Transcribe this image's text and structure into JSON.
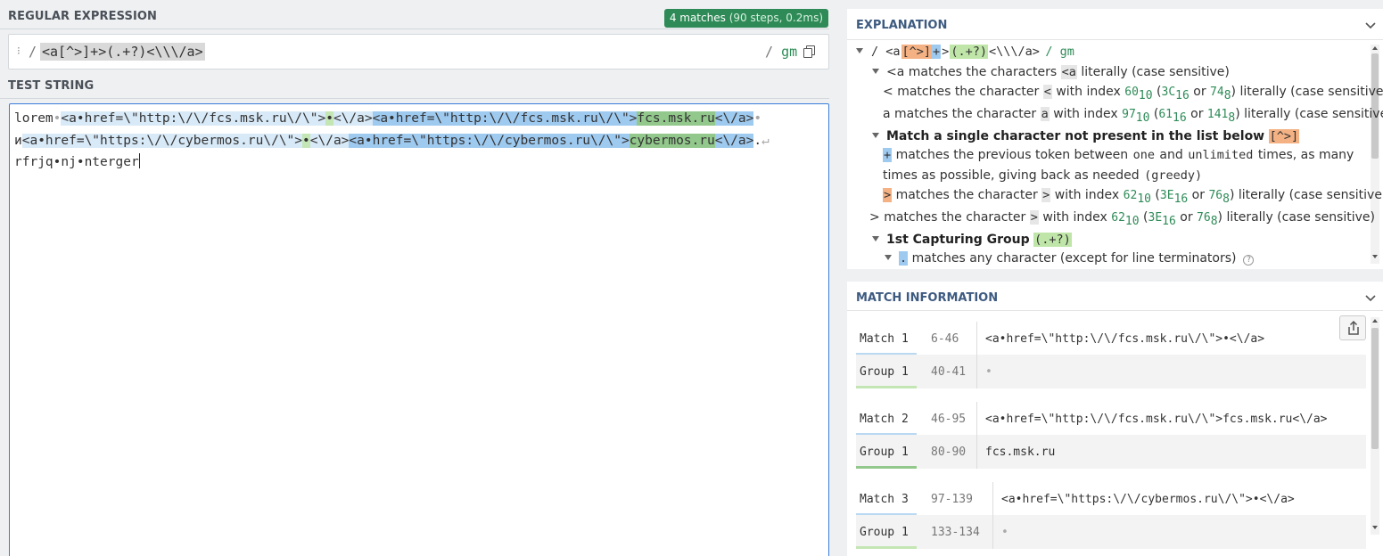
{
  "regex_panel": {
    "title": "REGULAR EXPRESSION",
    "matches_badge": "4 matches",
    "matches_detail": "(90 steps, 0.2ms)",
    "delimiter": "/",
    "pattern": "<a[^>]+>(.+?)<\\\\\\/a>",
    "flags_prefix": "/",
    "flags": "gm"
  },
  "test_panel": {
    "title": "TEST STRING",
    "line1": [
      {
        "t": "lorem",
        "c": ""
      },
      {
        "t": "•",
        "c": "ws"
      },
      {
        "t": "<a•href=\\\"http:\\/\\/fcs.msk.ru\\/\\\">",
        "c": "m-alt"
      },
      {
        "t": "•",
        "c": "g-light"
      },
      {
        "t": "<\\/a>",
        "c": "m-alt"
      },
      {
        "t": "<a•href=\\\"http:\\/\\/fcs.msk.ru\\/\\\">",
        "c": "m-blue"
      },
      {
        "t": "fcs.msk.ru",
        "c": "g-dark"
      },
      {
        "t": "<\\/a>",
        "c": "m-blue"
      },
      {
        "t": "•",
        "c": "ws"
      }
    ],
    "line2": [
      {
        "t": "и",
        "c": ""
      },
      {
        "t": "<a•href=\\\"https:\\/\\/cybermos.ru\\/\\\">",
        "c": "m-alt"
      },
      {
        "t": "•",
        "c": "g-light"
      },
      {
        "t": "<\\/a>",
        "c": "m-alt"
      },
      {
        "t": "<a•href=\\\"https:\\/\\/cybermos.ru\\/\\\">",
        "c": "m-blue"
      },
      {
        "t": "cybermos.ru",
        "c": "g-dark"
      },
      {
        "t": "<\\/a>",
        "c": "m-blue"
      },
      {
        "t": ".",
        "c": ""
      },
      {
        "t": "↵",
        "c": "ws"
      }
    ],
    "line3": "rfrjq•nj•nterger"
  },
  "explanation": {
    "title": "EXPLANATION",
    "root_open": "/ <a",
    "root_class": "[^>]",
    "root_plus": "+",
    "root_gt": ">",
    "root_group": "(.+?)",
    "root_tail": "<\\\\\\/a>",
    "root_flags": "/ gm",
    "row_a": {
      "token": "<a",
      "text1": "matches the characters",
      "lit": "<a",
      "text2": "literally (case sensitive)"
    },
    "row_lt": {
      "token": "<",
      "text1": "matches the character",
      "lit": "<",
      "text2": "with index",
      "dec": "60",
      "dec_base": "10",
      "hex": "3C",
      "hex_base": "16",
      "oct": "74",
      "oct_base": "8",
      "or": "or",
      "text3": "literally (case sensitive)"
    },
    "row_achar": {
      "token": "a",
      "text1": "matches the character",
      "lit": "a",
      "text2": "with index",
      "dec": "97",
      "dec_base": "10",
      "hex": "61",
      "hex_base": "16",
      "oct": "141",
      "oct_base": "8",
      "or": "or",
      "text3": "literally (case sensitive)"
    },
    "row_class": {
      "title": "Match a single character not present in the list below",
      "token": "[^>]"
    },
    "row_plus": {
      "token": "+",
      "text1": "matches the previous token between",
      "one": "one",
      "and": "and",
      "unlimited": "unlimited",
      "text2": "times, as many",
      "text3": "times as possible, giving back as needed",
      "greedy": "(greedy)"
    },
    "row_gt_in": {
      "token": ">",
      "text1": "matches the character",
      "lit": ">",
      "text2": "with index",
      "dec": "62",
      "dec_base": "10",
      "hex": "3E",
      "hex_base": "16",
      "oct": "76",
      "oct_base": "8",
      "or": "or",
      "text3": "literally (case sensitive)"
    },
    "row_gt": {
      "token": ">",
      "text1": "matches the character",
      "lit": ">",
      "text2": "with index",
      "dec": "62",
      "dec_base": "10",
      "hex": "3E",
      "hex_base": "16",
      "oct": "76",
      "oct_base": "8",
      "or": "or",
      "text3": "literally (case sensitive)"
    },
    "row_group": {
      "title": "1st Capturing Group",
      "token": "(.+?)"
    },
    "row_dot": {
      "token": ".",
      "text": "matches any character (except for line terminators)",
      "help": "?"
    }
  },
  "match_info": {
    "title": "MATCH INFORMATION",
    "rows": [
      {
        "label": "Match 1",
        "range": "6-46",
        "value": "<a•href=\\\"http:\\/\\/fcs.msk.ru\\/\\\">•<\\/a>",
        "kind": "match"
      },
      {
        "label": "Group 1",
        "range": "40-41",
        "value": "•",
        "kind": "group"
      },
      {
        "label": "Match 2",
        "range": "46-95",
        "value": "<a•href=\\\"http:\\/\\/fcs.msk.ru\\/\\\">fcs.msk.ru<\\/a>",
        "kind": "match"
      },
      {
        "label": "Group 1",
        "range": "80-90",
        "value": "fcs.msk.ru",
        "kind": "group"
      },
      {
        "label": "Match 3",
        "range": "97-139",
        "value": "<a•href=\\\"https:\\/\\/cybermos.ru\\/\\\">•<\\/a>",
        "kind": "match"
      },
      {
        "label": "Group 1",
        "range": "133-134",
        "value": "•",
        "kind": "group"
      }
    ]
  },
  "colors": {
    "badge": "#2e8b57",
    "focus_border": "#3b7dd8",
    "match_light": "#d8e9f7",
    "match_blue": "#9fcaf0",
    "group_light": "#c3e6b4",
    "group_dark": "#92c88c",
    "token_orange": "#f4b183",
    "panel_heading": "#3d5a80"
  },
  "icons": [
    "drag-handle-icon",
    "copy-icon",
    "chevron-down-icon",
    "share-icon",
    "help-circle-icon",
    "tree-toggle-icon"
  ]
}
